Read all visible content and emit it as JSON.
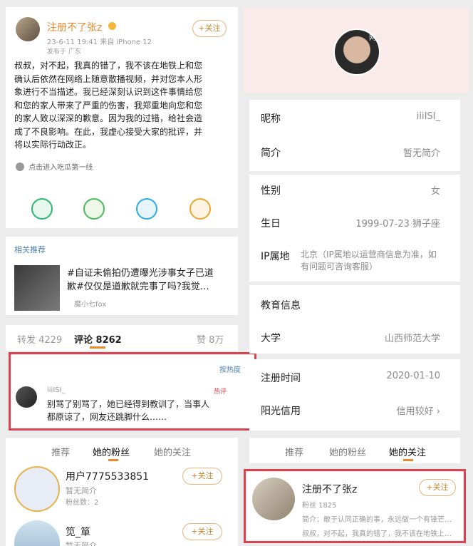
{
  "post": {
    "username": "注册不了张z",
    "verified_badge": "vip-crown-icon",
    "meta": "23-6-11 19:41 来自 iPhone 12",
    "location": "发布于 广东",
    "follow_label": "+关注",
    "body_lines": [
      "叔叔，对不起，我真的错了，我不该在地铁上和您",
      "确认后依然在网络上随意散播视频，并对您本人形",
      "象进行不当描述。我已经深刻认识到这件事情给您",
      "和您的家人带来了严重的伤害，我郑重地向您和您",
      "的家人致以深深的歉意。因为我的过错，给社会造",
      "成了不良影响。在此，我虚心接受大家的批评，并",
      "将以实际行动改正。"
    ],
    "topic_chip": "点击进入吃瓜第一线"
  },
  "related": {
    "header": "相关推荐",
    "title_line1": "#自证未偷拍仍遭曝光涉事女子已道",
    "title_line2": "歉#仅仅是道歉就完事了吗?我觉…",
    "author": "魔小七fox"
  },
  "stats": {
    "reposts": "转发 4229",
    "comments": "评论 8262",
    "likes": "赞 8万"
  },
  "comment": {
    "sort_label": "按热度",
    "author": "iiiISI_",
    "tag": "热评",
    "line1": "别骂了别骂了，她已经得到教训了，当事人",
    "line2": "都原谅了，网友还跳脚什么……"
  },
  "left_tabs": [
    "推荐",
    "她的粉丝",
    "她的关注"
  ],
  "fans": [
    {
      "name": "用户7775533851",
      "desc": "暂无简介",
      "count": "粉丝数：2",
      "follow": "+关注"
    },
    {
      "name": "笕_箪",
      "desc": "暂无简介",
      "follow": "+关注"
    }
  ],
  "profile": {
    "avatar_tag": "网",
    "rows": [
      {
        "k": "昵称",
        "v": "iiiISI_"
      },
      {
        "k": "简介",
        "v": "暂无简介"
      },
      {
        "k": "性别",
        "v": "女"
      },
      {
        "k": "生日",
        "v": "1999-07-23 狮子座"
      },
      {
        "k": "IP属地",
        "v": "北京（IP属地以运营商信息为准，如有问题可咨询客服）"
      },
      {
        "k": "教育信息",
        "v": ""
      },
      {
        "k": "大学",
        "v": "山西师范大学"
      },
      {
        "k": "注册时间",
        "v": "2020-01-10"
      },
      {
        "k": "阳光信用",
        "v": "信用较好 ›"
      }
    ]
  },
  "right_tabs": [
    "推荐",
    "她的粉丝",
    "她的关注"
  ],
  "following": {
    "name": "注册不了张z",
    "fans": "粉丝 1825",
    "follow": "+关注",
    "intro": "简介：敢于认同正确的事，永远做一个有锋芒…",
    "latest": "叔叔，对不起，我真的错了，我不该在地铁上…"
  },
  "colors": {
    "accent": "#e98a2e",
    "highlight": "#d9434f"
  }
}
